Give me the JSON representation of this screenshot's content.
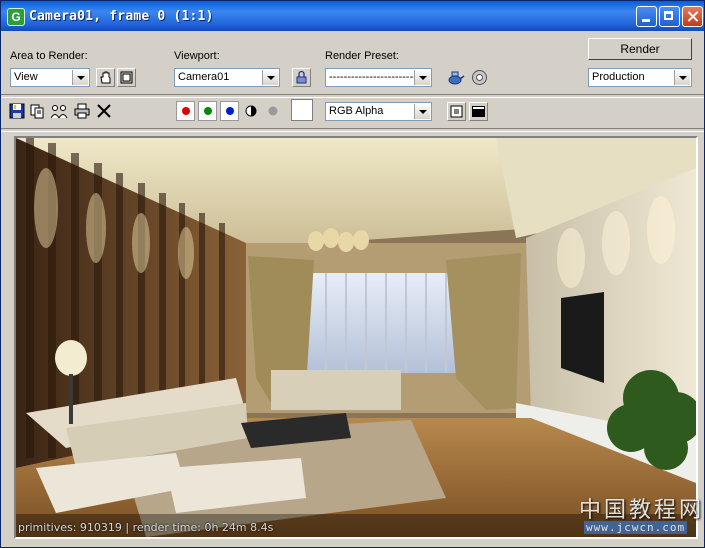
{
  "window": {
    "title": "Camera01, frame 0 (1:1)"
  },
  "controls": {
    "area_label": "Area to Render:",
    "area_value": "View",
    "viewport_label": "Viewport:",
    "viewport_value": "Camera01",
    "preset_label": "Render Preset:",
    "preset_value": "---------------------------",
    "render_button": "Render",
    "render_mode_value": "Production",
    "channel_value": "RGB Alpha"
  },
  "toolbar": {
    "icons": [
      "save-icon",
      "copy-icon",
      "clone-icon",
      "print-icon",
      "clear-icon"
    ],
    "channels": [
      {
        "name": "red-channel",
        "color": "#e00000"
      },
      {
        "name": "green-channel",
        "color": "#008a00"
      },
      {
        "name": "blue-channel",
        "color": "#0020d0"
      }
    ]
  },
  "render": {
    "status": "primitives: 910319 | render time: 0h 24m 8.4s",
    "watermark_cn": "中国教程网",
    "watermark_url": "www.jcwcn.com"
  }
}
